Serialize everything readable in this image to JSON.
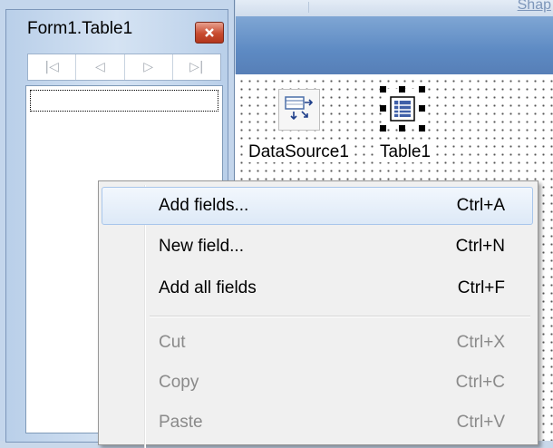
{
  "designer": {
    "top_tab_fragment": "Shap",
    "components": [
      {
        "label": "DataSource1",
        "icon": "datasource-icon"
      },
      {
        "label": "Table1",
        "icon": "table-icon"
      }
    ]
  },
  "form": {
    "title": "Form1.Table1",
    "close_icon": "close-icon",
    "nav_buttons": [
      {
        "glyph": "|◁",
        "icon": "first-record-icon"
      },
      {
        "glyph": "◁",
        "icon": "prior-record-icon"
      },
      {
        "glyph": "▷",
        "icon": "next-record-icon"
      },
      {
        "glyph": "▷|",
        "icon": "last-record-icon"
      }
    ]
  },
  "context_menu": {
    "items": [
      {
        "label": "Add fields...",
        "shortcut": "Ctrl+A",
        "enabled": true,
        "highlighted": true
      },
      {
        "label": "New field...",
        "shortcut": "Ctrl+N",
        "enabled": true
      },
      {
        "label": "Add all fields",
        "shortcut": "Ctrl+F",
        "enabled": true
      },
      {
        "label": "Cut",
        "shortcut": "Ctrl+X",
        "enabled": false
      },
      {
        "label": "Copy",
        "shortcut": "Ctrl+C",
        "enabled": false
      },
      {
        "label": "Paste",
        "shortcut": "Ctrl+V",
        "enabled": false
      }
    ]
  },
  "colors": {
    "highlight_border": "#a8c6eb",
    "close_button": "#c84b2f",
    "disabled_text": "#8a8a8a"
  }
}
